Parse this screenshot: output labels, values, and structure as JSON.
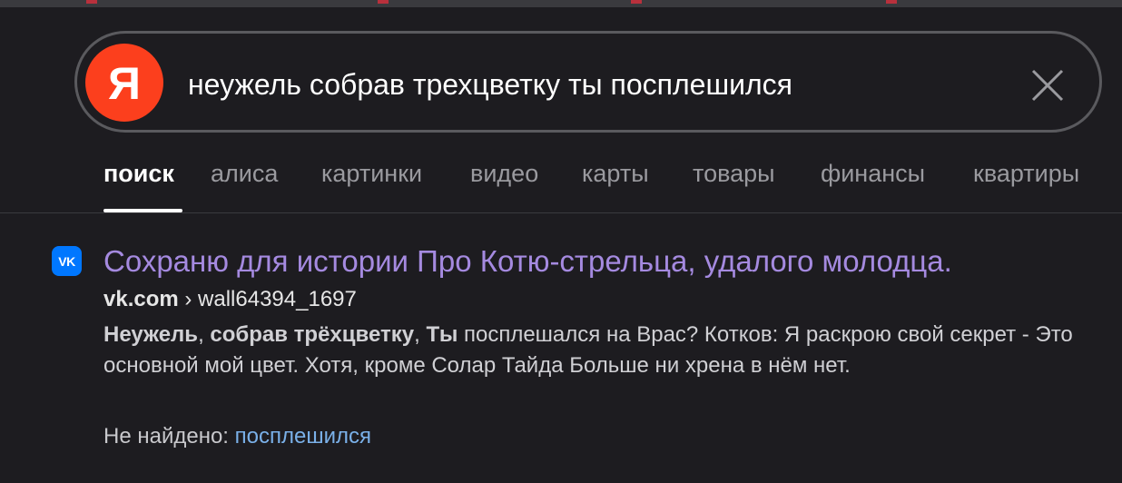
{
  "search": {
    "query": "неужель собрав трехцветку ты посплешился",
    "logo_letter": "Я"
  },
  "tabs": [
    {
      "label": "поиск",
      "active": true
    },
    {
      "label": "алиса"
    },
    {
      "label": "картинки"
    },
    {
      "label": "видео"
    },
    {
      "label": "карты"
    },
    {
      "label": "товары"
    },
    {
      "label": "финансы"
    },
    {
      "label": "квартиры"
    }
  ],
  "result": {
    "favicon_text": "VK",
    "title": "Сохраню для истории Про Котю-стрельца, удалого молодца.",
    "domain": "vk.com",
    "separator": " › ",
    "path": "wall64394_1697",
    "snippet_bold_1": "Неужель",
    "snippet_sep_1": ", ",
    "snippet_bold_2": "собрав трёхцветку",
    "snippet_sep_2": ", ",
    "snippet_bold_3": "Ты",
    "snippet_rest": " посплешался на Врас? Котков: Я раскрою свой секрет - Это основной мой цвет. Хотя, кроме Солар Тайда Больше ни хрена в нём нет.",
    "not_found_label": "Не найдено: ",
    "not_found_word": "посплешился"
  },
  "colors": {
    "background": "#1d1c20",
    "logo": "#fc3f1d",
    "title_link": "#a58ae0",
    "vk_blue": "#0077ff",
    "not_found_link": "#7ab0e8"
  },
  "icons": {
    "logo": "yandex-logo",
    "clear": "close-icon",
    "favicon": "vk-icon"
  }
}
